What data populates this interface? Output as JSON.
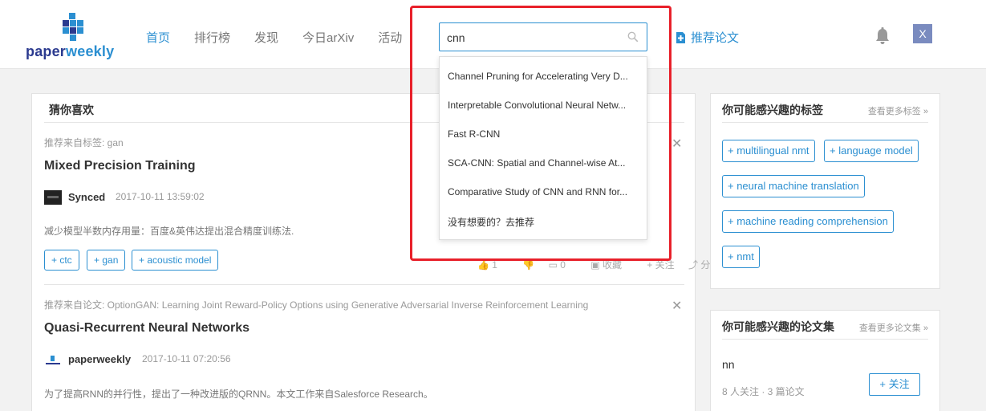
{
  "header": {
    "logo": {
      "part1": "paper",
      "part2": "weekly"
    },
    "nav": [
      {
        "label": "首页",
        "active": true
      },
      {
        "label": "排行榜",
        "active": false
      },
      {
        "label": "发现",
        "active": false
      },
      {
        "label": "今日arXiv",
        "active": false
      },
      {
        "label": "活动",
        "active": false
      }
    ],
    "recommend_label": "推荐论文",
    "avatar_letter": "X"
  },
  "search": {
    "value": "cnn",
    "suggestions": [
      "Channel Pruning for Accelerating Very D...",
      "Interpretable Convolutional Neural Netw...",
      "Fast R-CNN",
      "SCA-CNN: Spatial and Channel-wise At...",
      "Comparative Study of CNN and RNN for...",
      "没有想要的？去推荐"
    ]
  },
  "feed": {
    "title": "猜你喜欢",
    "items": [
      {
        "source": "推荐来自标签: gan",
        "title": "Mixed Precision Training",
        "author": "Synced",
        "time": "2017-10-11 13:59:02",
        "summary": "减少模型半数内存用量：百度&英伟达提出混合精度训练法.",
        "tags": [
          "+ ctc",
          "+ gan",
          "+ acoustic model"
        ],
        "actions": {
          "like": "1",
          "comment": "0",
          "collect": "收藏",
          "follow": "+ 关注",
          "share": "分享"
        }
      },
      {
        "source": "推荐来自论文: OptionGAN: Learning Joint Reward-Policy Options using Generative Adversarial Inverse Reinforcement Learning",
        "title": "Quasi-Recurrent Neural Networks",
        "author": "paperweekly",
        "time": "2017-10-11 07:20:56",
        "summary": "为了提高RNN的并行性，提出了一种改进版的QRNN。本文工作来自Salesforce Research。"
      }
    ]
  },
  "tags_panel": {
    "title": "你可能感兴趣的标签",
    "more": "查看更多标签 »",
    "tags": [
      "+ multilingual nmt",
      "+ language model",
      "+ neural machine translation",
      "+ machine reading comprehension",
      "+ nmt"
    ]
  },
  "collections_panel": {
    "title": "你可能感兴趣的论文集",
    "more": "查看更多论文集 »",
    "item": {
      "name": "nn",
      "meta": "8 人关注 · 3 篇论文",
      "follow": "+ 关注"
    }
  },
  "colors": {
    "accent": "#2b8fd1",
    "highlight": "#e8202a",
    "logo_dark": "#2b3a8f"
  }
}
